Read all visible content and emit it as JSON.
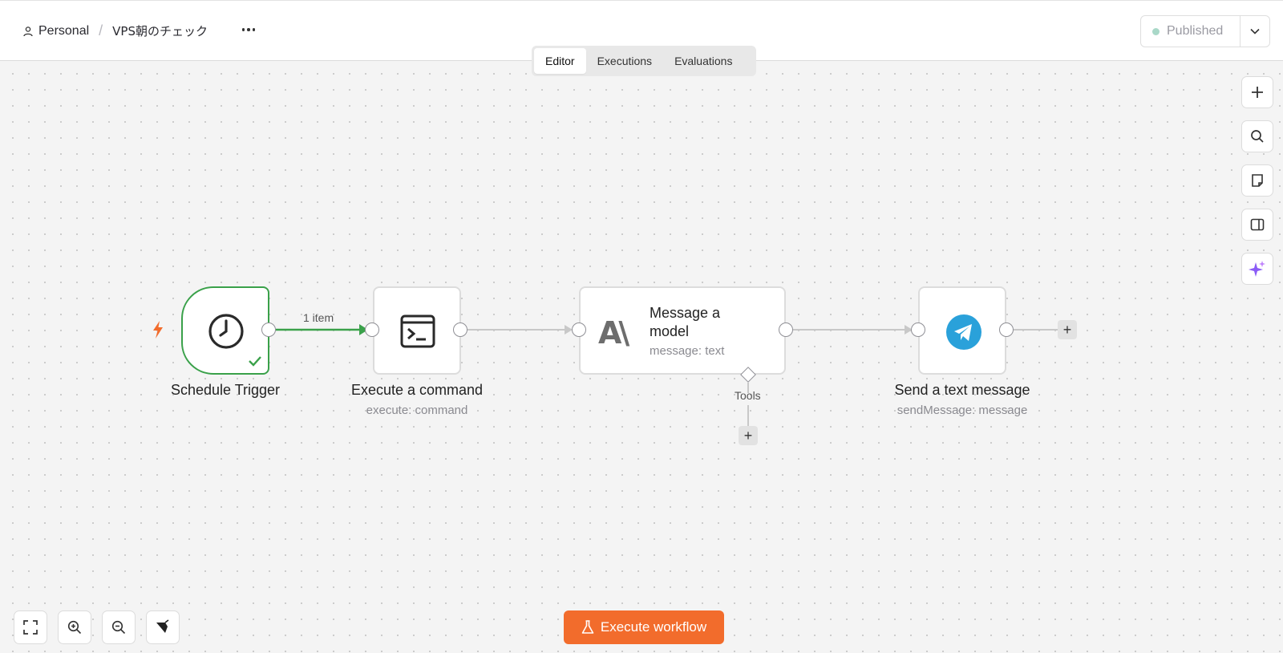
{
  "header": {
    "breadcrumb_owner": "Personal",
    "breadcrumb_separator": "/",
    "workflow_title": "VPS朝のチェック",
    "publish_label": "Published"
  },
  "tabs": [
    {
      "label": "Editor",
      "active": true
    },
    {
      "label": "Executions",
      "active": false
    },
    {
      "label": "Evaluations",
      "active": false
    }
  ],
  "nodes": {
    "schedule": {
      "label": "Schedule Trigger",
      "status_color": "#3aa14a"
    },
    "command": {
      "label": "Execute a command",
      "subtitle": "execute: command"
    },
    "model": {
      "title": "Message a model",
      "subtitle": "message: text",
      "tools_label": "Tools"
    },
    "telegram": {
      "label": "Send a text message",
      "subtitle": "sendMessage: message"
    }
  },
  "connections": {
    "schedule_to_command_label": "1 item"
  },
  "actions": {
    "execute_label": "Execute workflow"
  },
  "colors": {
    "accent": "#f26c2c",
    "success": "#3aa14a",
    "telegram": "#2aa1da"
  }
}
